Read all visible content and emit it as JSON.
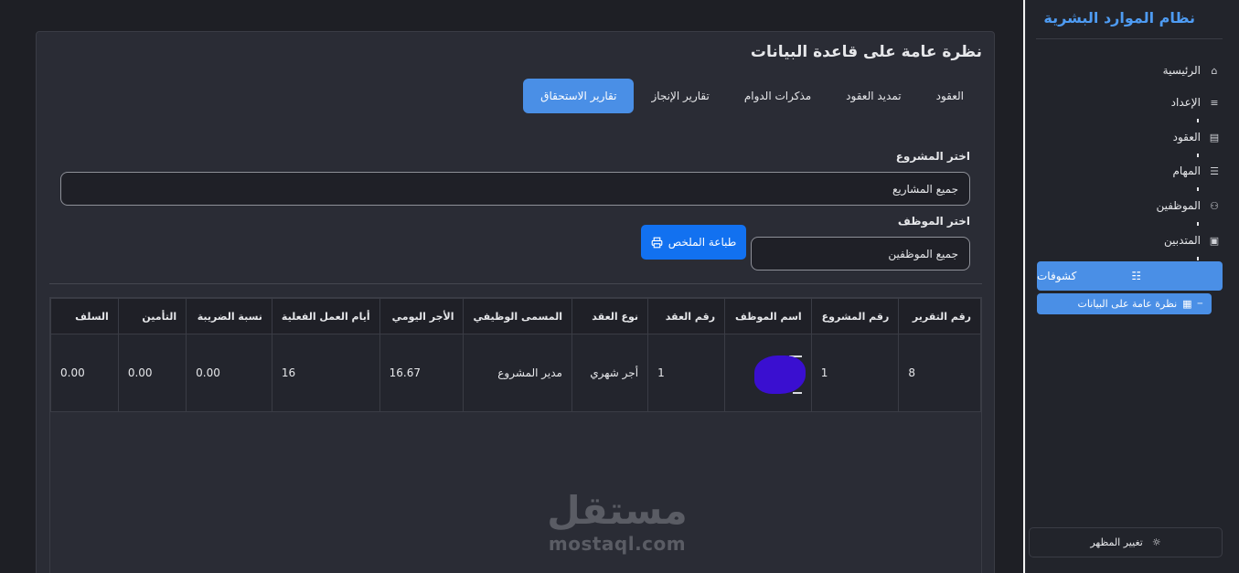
{
  "sidebar": {
    "title": "نظام الموارد البشرية",
    "items": [
      {
        "label": "الرئيسية",
        "icon": "home-icon",
        "glyph": "⌂"
      },
      {
        "label": "الإعداد",
        "icon": "sliders-icon",
        "glyph": "≡"
      },
      {
        "label": "العقود",
        "icon": "file-icon",
        "glyph": "▤"
      },
      {
        "label": "المهام",
        "icon": "list-icon",
        "glyph": "☰"
      },
      {
        "label": "الموظفين",
        "icon": "users-icon",
        "glyph": "⚇"
      },
      {
        "label": "المتدبين",
        "icon": "user-card-icon",
        "glyph": "▣"
      }
    ],
    "active": {
      "label": "كشوفات",
      "icon": "database-icon",
      "glyph": "☷"
    },
    "sub_item": {
      "label": "نظرة عامة على البيانات",
      "icon": "table-icon",
      "glyph": "▦"
    },
    "theme_toggle": {
      "label": "تغيير المظهر",
      "icon": "sun-icon",
      "glyph": "☼"
    }
  },
  "main": {
    "title": "نظرة عامة على قاعدة البيانات",
    "tabs": [
      "العقود",
      "تمديد العقود",
      "مذكرات الدوام",
      "تقارير الإنجاز",
      "تقارير الاستحقاق"
    ],
    "active_tab": "تقارير الاستحقاق",
    "project_label": "اختر المشروع",
    "project_value": "جميع المشاريع",
    "employee_label": "اختر الموظف",
    "employee_value": "جميع الموظفين",
    "print_button": "طباعة الملخص",
    "print_icon": "printer-icon"
  },
  "table": {
    "headers": [
      "رقم التقرير",
      "رقم المشروع",
      "اسم الموظف",
      "رقم العقد",
      "نوع العقد",
      "المسمى الوظيفي",
      "الأجر اليومي",
      "أيام العمل الفعلية",
      "نسبة الضريبة",
      "التأمين",
      "السلف"
    ],
    "rows": [
      [
        "8",
        "1",
        "",
        "1",
        "أجر شهري",
        "مدير المشروع",
        "16.67",
        "16",
        "0.00",
        "0.00",
        "0.00"
      ]
    ]
  },
  "watermark": {
    "arabic": "مستقل",
    "latin": "mostaql.com"
  }
}
